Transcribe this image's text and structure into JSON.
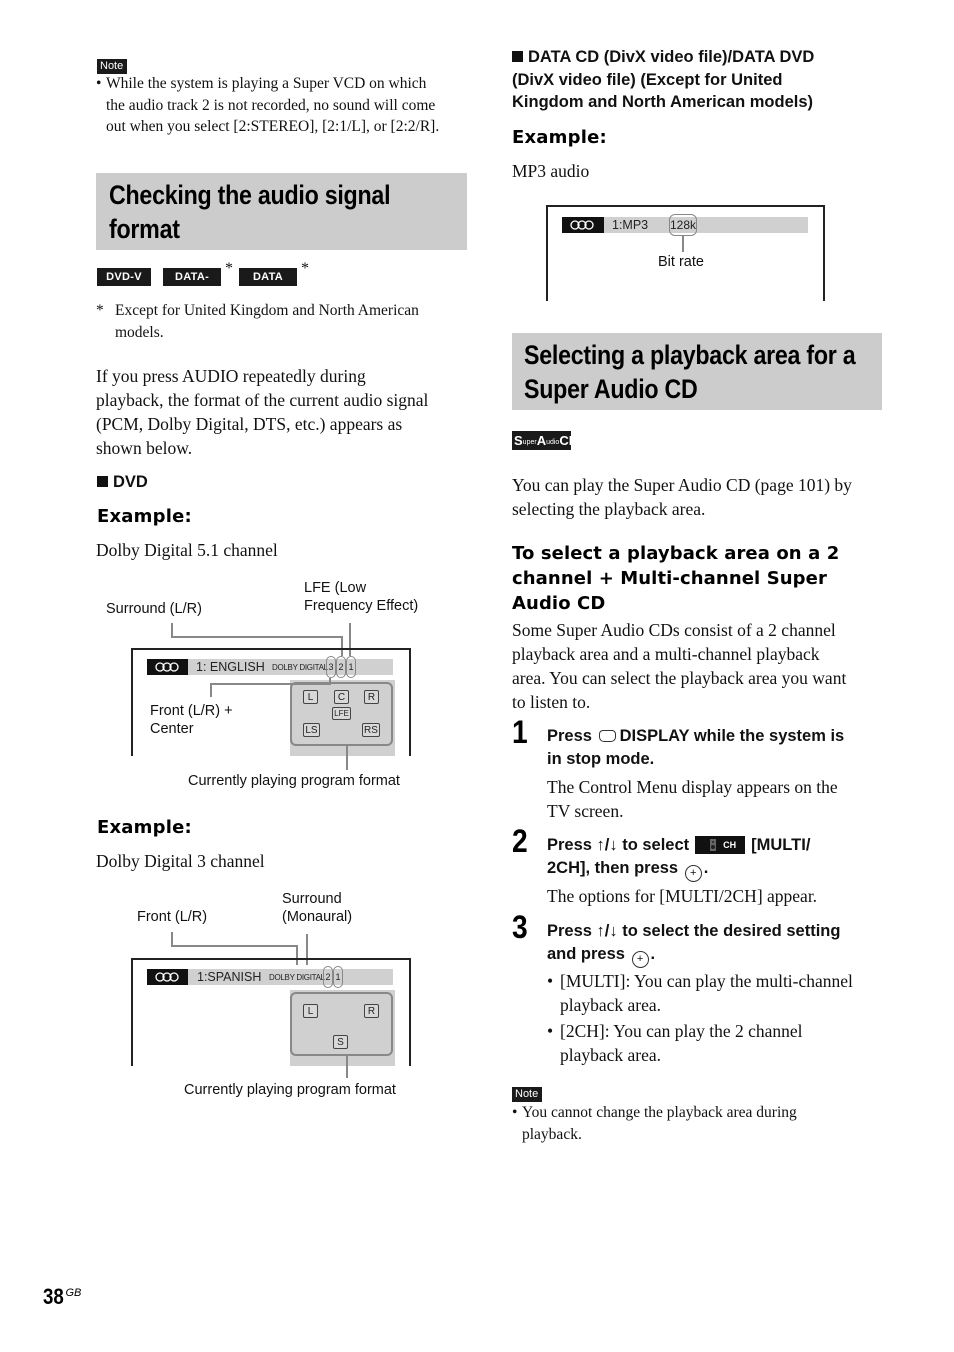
{
  "left_column": {
    "top_note": {
      "badge": "Note",
      "bullet": "•",
      "lines": [
        "While the system is playing a Super VCD on which",
        "the audio track 2 is not recorded, no sound will come",
        "out when you select [2:STEREO], [2:1/L], or [2:2/R]."
      ]
    },
    "section_title_lines": [
      "Checking the audio signal",
      "format"
    ],
    "media_badges": [
      {
        "label": "DVD-V",
        "asterisk": ""
      },
      {
        "label": "DATA-CD",
        "asterisk": "*"
      },
      {
        "label": "DATA DVD",
        "asterisk": "*"
      }
    ],
    "footnote": {
      "mark": "*",
      "lines": [
        "Except for United Kingdom and North American",
        "models."
      ]
    },
    "intro_lines": [
      "If you press AUDIO repeatedly during",
      "playback, the format of the current audio signal",
      "(PCM, Dolby Digital, DTS, etc.) appears as",
      "shown below."
    ],
    "dvd_heading": "DVD",
    "example1": {
      "label": "Example:",
      "caption": "Dolby Digital 5.1 channel",
      "callouts": {
        "surround": "Surround (L/R)",
        "lfe_line1": "LFE (Low",
        "lfe_line2": "Frequency Effect)",
        "front_line1": "Front (L/R) +",
        "front_line2": "Center",
        "format": "Currently playing program format"
      },
      "osd": {
        "track": "1: ENGLISH",
        "codec": "DOLBY DIGITAL",
        "channels": [
          "3",
          "2",
          "1"
        ],
        "speakers": [
          "L",
          "C",
          "R",
          "LFE",
          "LS",
          "RS"
        ]
      }
    },
    "example2": {
      "label": "Example:",
      "caption": "Dolby Digital 3 channel",
      "callouts": {
        "front": "Front (L/R)",
        "surround_line1": "Surround",
        "surround_line2": "(Monaural)",
        "format": "Currently playing program format"
      },
      "osd": {
        "track": "1:SPANISH",
        "codec": "DOLBY DIGITAL",
        "channels": [
          "2",
          "1"
        ],
        "speakers": [
          "L",
          "R",
          "S"
        ]
      }
    }
  },
  "right_column": {
    "divx_heading_lines": [
      "DATA CD (DivX video file)/DATA DVD",
      "(DivX video file) (Except for United",
      "Kingdom and North American models)"
    ],
    "example3": {
      "label": "Example:",
      "caption": "MP3 audio",
      "osd": {
        "track": "1:MP3",
        "bitrate": "128k"
      },
      "callout": "Bit rate"
    },
    "section_title_lines": [
      "Selecting a playback area for a",
      "Super Audio CD"
    ],
    "sacd_badge": {
      "s": "S",
      "uper": "uper ",
      "a": "A",
      "udio": "udio",
      "cd": "CD"
    },
    "intro_lines": [
      "You can play the Super Audio CD (page 101) by",
      "selecting the playback area."
    ],
    "subsection_title_lines": [
      "To select a playback area on a 2",
      "channel + Multi-channel Super",
      "Audio CD"
    ],
    "subsection_body_lines": [
      "Some Super Audio CDs consist of a 2 channel",
      "playback area and a multi-channel playback",
      "area. You can select the playback area you want",
      "to listen to."
    ],
    "steps": [
      {
        "number": "1",
        "head_part1": "Press",
        "head_part2": "DISPLAY while the system is",
        "head_line2": "in stop mode.",
        "body_lines": [
          "The Control Menu display appears on the",
          "TV screen."
        ]
      },
      {
        "number": "2",
        "head_part1": "Press ↑/↓ to select",
        "icon_label": "CH",
        "head_part2": "[MULTI/",
        "head_line2": "2CH], then press",
        "enter_symbol": "+",
        "end": ".",
        "body_lines": [
          "The options for [MULTI/2CH] appear."
        ]
      },
      {
        "number": "3",
        "head_part1": "Press ↑/↓ to select the desired setting",
        "head_line2": "and press",
        "enter_symbol": "+",
        "end": ".",
        "bullets": [
          {
            "lines": [
              "[MULTI]: You can play the multi-channel",
              "playback area."
            ]
          },
          {
            "lines": [
              "[2CH]: You can play the 2 channel",
              "playback area."
            ]
          }
        ]
      }
    ],
    "bottom_note": {
      "badge": "Note",
      "bullet": "•",
      "lines": [
        "You cannot change the playback area during",
        "playback."
      ]
    }
  },
  "footer": {
    "page_number": "38",
    "suffix": "GB"
  }
}
